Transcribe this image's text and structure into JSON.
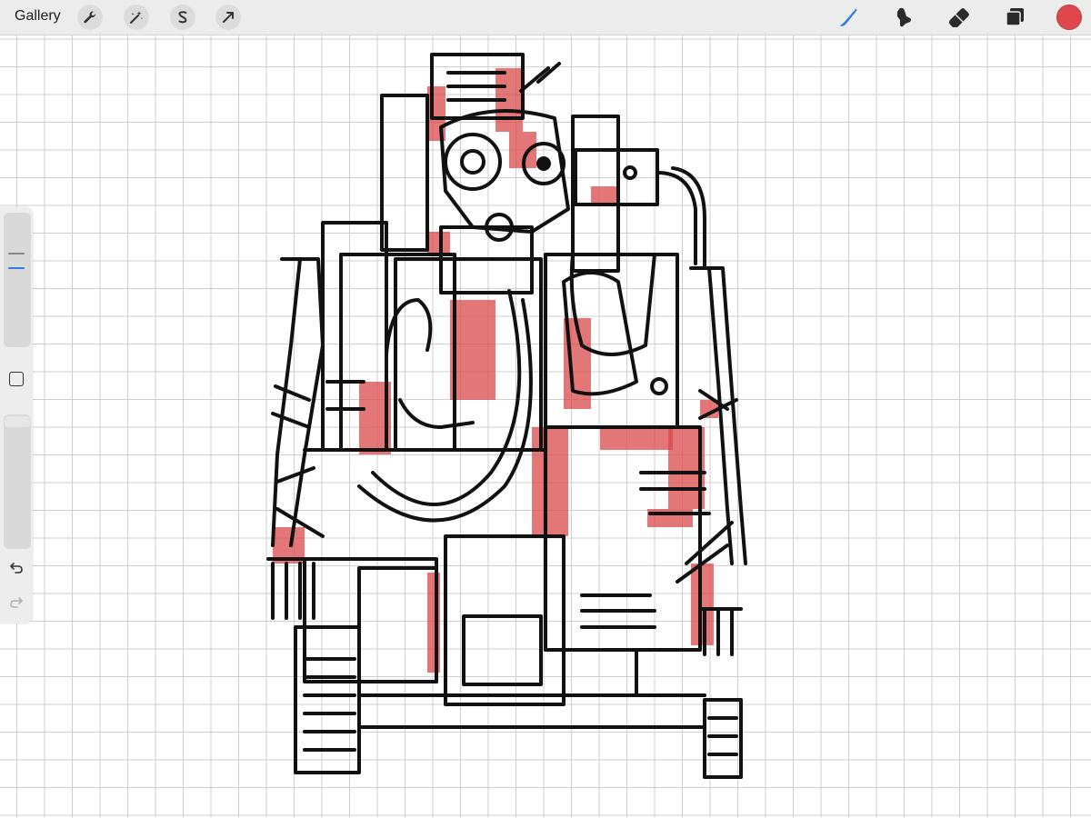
{
  "toolbar": {
    "gallery_label": "Gallery",
    "left_tools": [
      "wrench-icon",
      "magic-wand-icon",
      "selection-s-icon",
      "transform-arrow-icon"
    ],
    "right_tools": [
      "brush-icon",
      "smudge-icon",
      "eraser-icon",
      "layers-icon"
    ],
    "active_tool": "brush",
    "active_tool_color": "#2f7de1",
    "current_color": "#e0474c"
  },
  "sidebar": {
    "brush_size": 0.4,
    "opacity": 1.0,
    "controls": [
      "brush-size-slider",
      "modify-button",
      "opacity-slider",
      "undo-icon",
      "redo-icon"
    ]
  },
  "canvas": {
    "grid": true,
    "stroke_color": "#111111",
    "accent_color": "#d94a4a"
  }
}
